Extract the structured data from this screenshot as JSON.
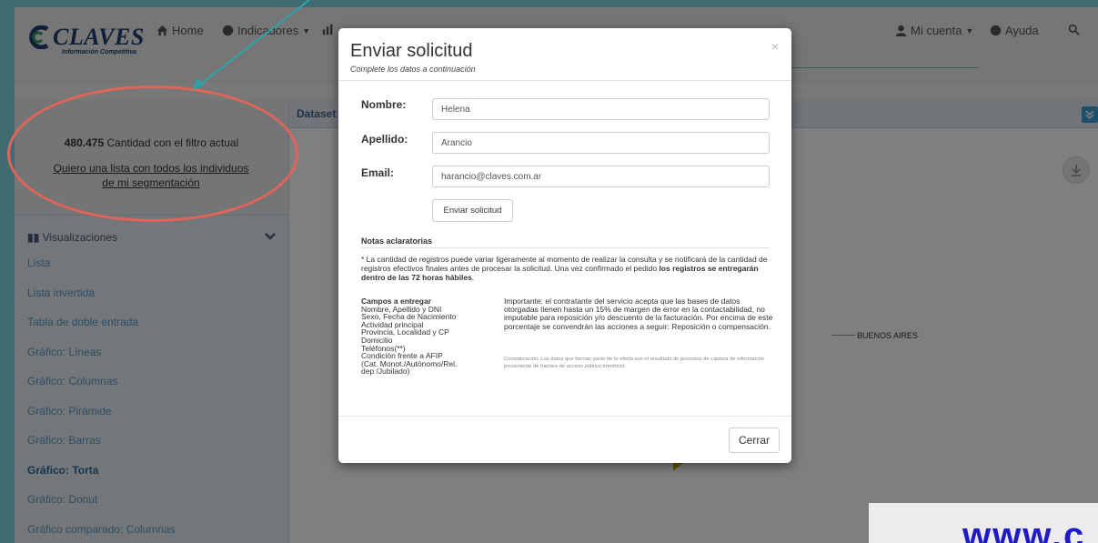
{
  "brand": {
    "name": "CLAVES",
    "tagline": "Información Competitiva"
  },
  "nav": {
    "home": "Home",
    "indicadores": "Indicadores",
    "cuenta": "Mi cuenta",
    "ayuda": "Ayuda"
  },
  "sidebar": {
    "filter_count": "480.475",
    "filter_count_label": "Cantidad con el filtro actual",
    "filter_link": "Quiero una lista con todos los individuos de mi segmentación",
    "visualizations_header": "Visualizaciones",
    "items": [
      {
        "label": "Lista"
      },
      {
        "label": "Lista invertida"
      },
      {
        "label": "Tabla de doble entrada"
      },
      {
        "label": "Gráfico: Líneas"
      },
      {
        "label": "Gráfico: Columnas"
      },
      {
        "label": "Gráfico: Pirámide"
      },
      {
        "label": "Gráfico: Barras"
      },
      {
        "label": "Gráfico: Torta",
        "active": true
      },
      {
        "label": "Gráfico: Donut"
      },
      {
        "label": "Gráfico comparado: Columnas"
      }
    ]
  },
  "main": {
    "dataset_tab": "Dataset",
    "pie_label": "BUENOS AIRES",
    "pie_color": "#c8a400"
  },
  "modal": {
    "title": "Enviar solicitud",
    "subtitle": "Complete los datos a continuación",
    "close_icon": "×",
    "fields": {
      "nombre_label": "Nombre:",
      "nombre_value": "Helena",
      "apellido_label": "Apellido:",
      "apellido_value": "Arancio",
      "email_label": "Email:",
      "email_value": "harancio@claves.com.ar"
    },
    "send_button": "Enviar solicitud",
    "notes_title": "Notas aclaratorias",
    "notes_text": "* La cantidad de registros puede variar ligeramente al momento de realizar la consulta y se notificará de la cantidad de registros efectivos finales antes de procesar la solicitud. Una vez confirmado el pedido",
    "notes_bold": "los registros se entregarán dentro de las 72 horas hábiles",
    "notes_end": ".",
    "fields_title": "Campos a entregar",
    "fields_list": [
      "Nombre, Apellido y DNI",
      "Sexo, Fecha de Nacimiento",
      "Actividad principal",
      "Provincia, Localidad y CP",
      "Domicilio",
      "Teléfonos(**)",
      "Condición frente a AFIP",
      "(Cat. Monot./Autónomo/Rel.",
      "dep /Jubilado)"
    ],
    "important_text": "Importante: el contratante del servicio acepta que las bases de datos otorgadas tienen hasta un 15% de margen de error en la contactabilidad, no imputable para reposición y/o descuento de la facturación. Por encima de este porcentaje se convendrán las acciones a seguir: Reposición o compensación.",
    "consideration_text": "Consideración: Los datos que forman parte de la oferta son el resultado de procesos de captura de información proveniente de fuentes de acceso público irrestricto.",
    "close_button": "Cerrar"
  },
  "watermark": {
    "text": "www.c"
  },
  "colors": {
    "annotation_ellipse": "#e0645a",
    "annotation_arrow": "#2aa5a9",
    "link": "#5b9bc7",
    "watermark": "#1f1ac9"
  }
}
